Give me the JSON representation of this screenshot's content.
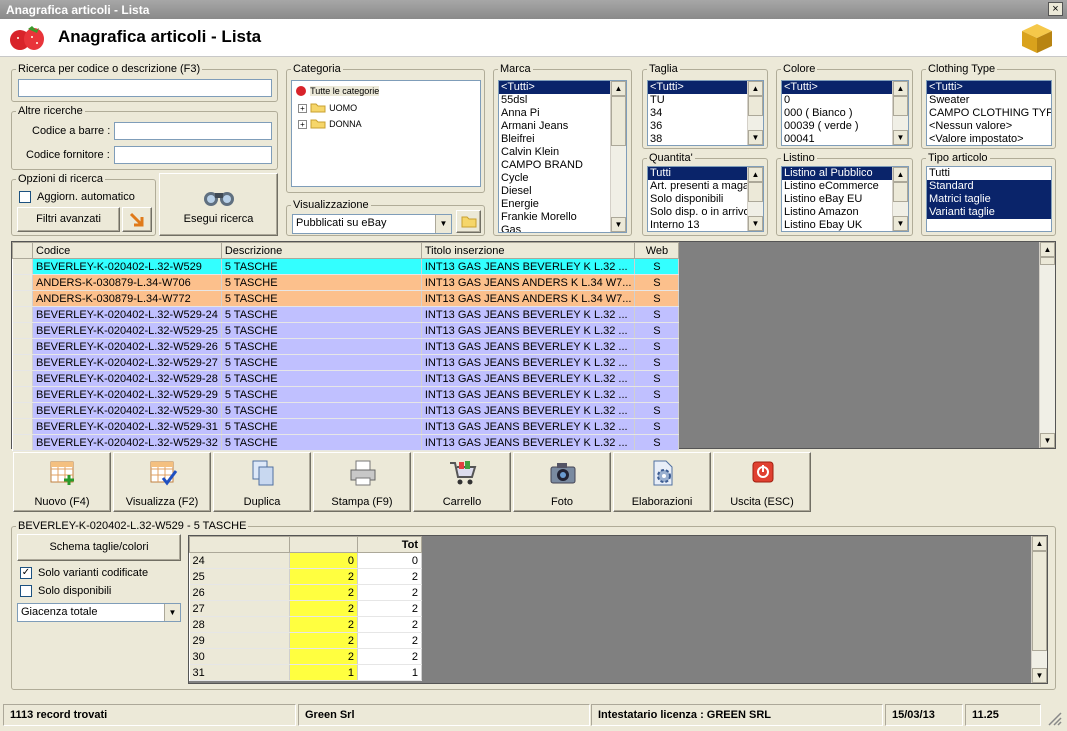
{
  "window": {
    "title": "Anagrafica articoli  - Lista",
    "header_title": "Anagrafica articoli  - Lista",
    "close_glyph": "×"
  },
  "search": {
    "legend": "Ricerca per codice o descrizione (F3)",
    "value": "",
    "other_legend": "Altre ricerche",
    "barcode_label": "Codice a barre :",
    "supplier_label": "Codice fornitore :",
    "options_legend": "Opzioni di ricerca",
    "auto_update_label": "Aggiorn. automatico",
    "advanced_filters": "Filtri avanzati",
    "run_search": "Esegui ricerca"
  },
  "categoria": {
    "legend": "Categoria",
    "root": "Tutte le categorie",
    "nodes": [
      "UOMO",
      "DONNA"
    ]
  },
  "visualizzazione": {
    "legend": "Visualizzazione",
    "selected": "Pubblicati su eBay"
  },
  "marca": {
    "legend": "Marca",
    "items": [
      "<Tutti>",
      "55dsl",
      "Anna Pi",
      "Armani Jeans",
      "Bleifrei",
      "Calvin Klein",
      "CAMPO BRAND",
      "Cycle",
      "Diesel",
      "Energie",
      "Frankie Morello",
      "Gas"
    ]
  },
  "taglia": {
    "legend": "Taglia",
    "items": [
      "<Tutti>",
      "TU",
      "34",
      "36",
      "38"
    ]
  },
  "colore": {
    "legend": "Colore",
    "items": [
      "<Tutti>",
      "0",
      "000 ( Bianco )",
      "00039 ( verde )",
      "00041"
    ]
  },
  "clothing": {
    "legend": "Clothing Type",
    "items": [
      "<Tutti>",
      "Sweater",
      "CAMPO CLOTHING TYPE",
      "<Nessun valore>",
      "<Valore impostato>"
    ]
  },
  "quantita": {
    "legend": "Quantita'",
    "items": [
      "Tutti",
      "Art. presenti a magazzino",
      "Solo disponibili",
      "Solo disp. o in arrivo",
      "Interno 13"
    ]
  },
  "listino": {
    "legend": "Listino",
    "items": [
      "Listino al Pubblico",
      "Listino eCommerce",
      "Listino eBay EU",
      "Listino Amazon",
      "Listino Ebay UK"
    ]
  },
  "tipo": {
    "legend": "Tipo articolo",
    "items": [
      "Tutti",
      "Standard",
      "Matrici taglie",
      "Varianti taglie"
    ]
  },
  "grid": {
    "headers": [
      "Codice",
      "Descrizione",
      "Titolo inserzione",
      "Web"
    ],
    "rows": [
      {
        "codice": "BEVERLEY-K-020402-L.32-W529",
        "desc": "5 TASCHE",
        "titolo": "INT13 GAS JEANS BEVERLEY K L.32 ...",
        "web": "S",
        "color": "#33ffff"
      },
      {
        "codice": "ANDERS-K-030879-L.34-W706",
        "desc": "5 TASCHE",
        "titolo": "INT13 GAS JEANS ANDERS K L.34 W7...",
        "web": "S",
        "color": "#fcc08c"
      },
      {
        "codice": "ANDERS-K-030879-L.34-W772",
        "desc": "5 TASCHE",
        "titolo": "INT13 GAS JEANS ANDERS K L.34 W7...",
        "web": "S",
        "color": "#fcc08c"
      },
      {
        "codice": "BEVERLEY-K-020402-L.32-W529-24",
        "desc": "5 TASCHE",
        "titolo": "INT13 GAS JEANS BEVERLEY K L.32 ...",
        "web": "S",
        "color": "#c0c0ff"
      },
      {
        "codice": "BEVERLEY-K-020402-L.32-W529-25",
        "desc": "5 TASCHE",
        "titolo": "INT13 GAS JEANS BEVERLEY K L.32 ...",
        "web": "S",
        "color": "#c0c0ff"
      },
      {
        "codice": "BEVERLEY-K-020402-L.32-W529-26",
        "desc": "5 TASCHE",
        "titolo": "INT13 GAS JEANS BEVERLEY K L.32 ...",
        "web": "S",
        "color": "#c0c0ff"
      },
      {
        "codice": "BEVERLEY-K-020402-L.32-W529-27",
        "desc": "5 TASCHE",
        "titolo": "INT13 GAS JEANS BEVERLEY K L.32 ...",
        "web": "S",
        "color": "#c0c0ff"
      },
      {
        "codice": "BEVERLEY-K-020402-L.32-W529-28",
        "desc": "5 TASCHE",
        "titolo": "INT13 GAS JEANS BEVERLEY K L.32 ...",
        "web": "S",
        "color": "#c0c0ff"
      },
      {
        "codice": "BEVERLEY-K-020402-L.32-W529-29",
        "desc": "5 TASCHE",
        "titolo": "INT13 GAS JEANS BEVERLEY K L.32 ...",
        "web": "S",
        "color": "#c0c0ff"
      },
      {
        "codice": "BEVERLEY-K-020402-L.32-W529-30",
        "desc": "5 TASCHE",
        "titolo": "INT13 GAS JEANS BEVERLEY K L.32 ...",
        "web": "S",
        "color": "#c0c0ff"
      },
      {
        "codice": "BEVERLEY-K-020402-L.32-W529-31",
        "desc": "5 TASCHE",
        "titolo": "INT13 GAS JEANS BEVERLEY K L.32 ...",
        "web": "S",
        "color": "#c0c0ff"
      },
      {
        "codice": "BEVERLEY-K-020402-L.32-W529-32",
        "desc": "5 TASCHE",
        "titolo": "INT13 GAS JEANS BEVERLEY K L.32 ...",
        "web": "S",
        "color": "#c0c0ff"
      }
    ]
  },
  "toolbar": [
    "Nuovo (F4)",
    "Visualizza (F2)",
    "Duplica",
    "Stampa (F9)",
    "Carrello",
    "Foto",
    "Elaborazioni",
    "Uscita (ESC)"
  ],
  "detail": {
    "legend": "BEVERLEY-K-020402-L.32-W529 - 5 TASCHE",
    "schema_button": "Schema taglie/colori",
    "solo_varianti": "Solo varianti codificate",
    "solo_disponibili": "Solo disponibili",
    "giacenza": "Giacenza totale",
    "tot_header": "Tot",
    "rows": [
      {
        "size": "24",
        "v": "0",
        "tot": "0"
      },
      {
        "size": "25",
        "v": "2",
        "tot": "2"
      },
      {
        "size": "26",
        "v": "2",
        "tot": "2"
      },
      {
        "size": "27",
        "v": "2",
        "tot": "2"
      },
      {
        "size": "28",
        "v": "2",
        "tot": "2"
      },
      {
        "size": "29",
        "v": "2",
        "tot": "2"
      },
      {
        "size": "30",
        "v": "2",
        "tot": "2"
      },
      {
        "size": "31",
        "v": "1",
        "tot": "1"
      }
    ]
  },
  "statusbar": {
    "records": "1113 record trovati",
    "company": "Green Srl",
    "license": "Intestatario licenza : GREEN SRL",
    "date": "15/03/13",
    "time": "11.25"
  },
  "colors": {
    "highlight": "#0a246a",
    "yellow": "#ffff40"
  }
}
